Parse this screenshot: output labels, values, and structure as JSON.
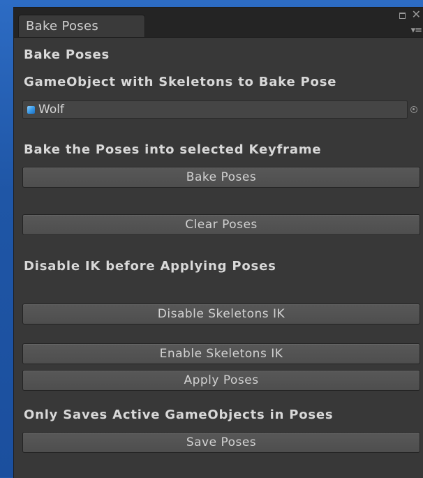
{
  "tab": {
    "title": "Bake Poses"
  },
  "panel": {
    "title": "Bake Poses",
    "skeleton_heading": "GameObject with Skeletons to Bake Pose",
    "object_field_value": "Wolf",
    "bake_heading": "Bake the Poses into selected Keyframe",
    "bake_button": "Bake Poses",
    "clear_button": "Clear Poses",
    "ik_heading": "Disable IK before Applying Poses",
    "disable_ik_button": "Disable Skeletons IK",
    "enable_ik_button": "Enable Skeletons IK",
    "apply_button": "Apply Poses",
    "save_heading": "Only Saves Active GameObjects in Poses",
    "save_button": "Save Poses"
  },
  "icons": {
    "maximize": "maximize-icon",
    "close": "close-icon",
    "menu": "menu-icon",
    "object": "cube-icon",
    "picker": "object-picker-icon"
  },
  "colors": {
    "panel_bg": "#383838",
    "button_bg": "#585858",
    "text": "#d8d8d8",
    "desktop": "#2257a8",
    "cube": "#3b9be8"
  }
}
